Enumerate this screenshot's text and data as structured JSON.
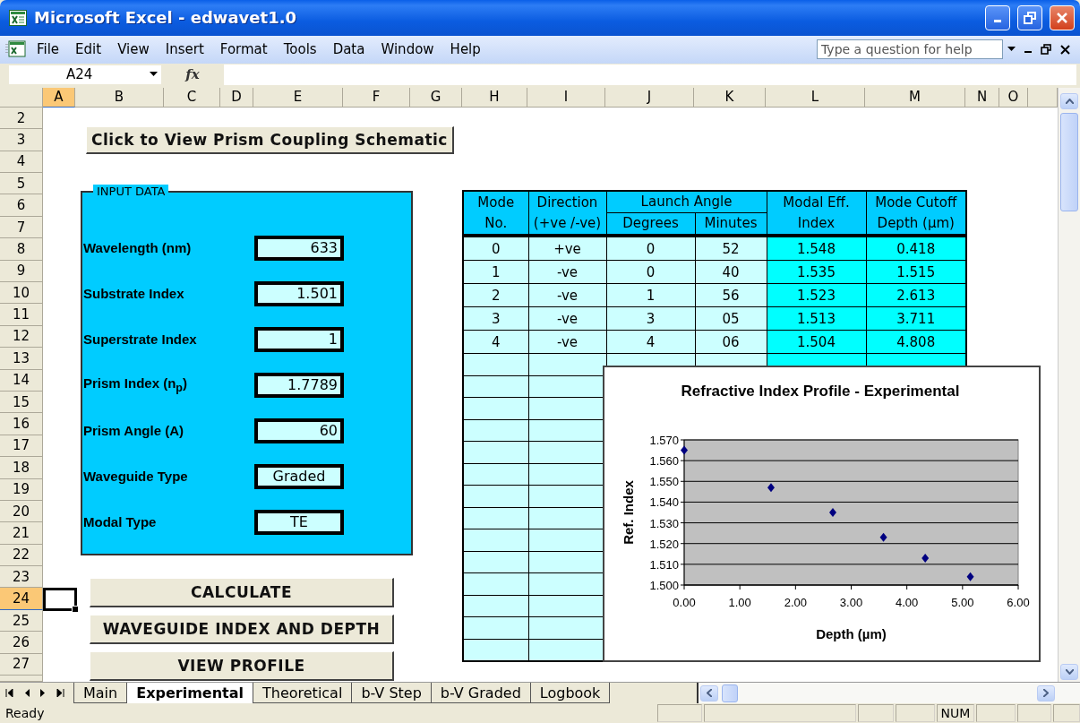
{
  "window": {
    "title": "Microsoft Excel - edwavet1.0"
  },
  "menu": [
    "File",
    "Edit",
    "View",
    "Insert",
    "Format",
    "Tools",
    "Data",
    "Window",
    "Help"
  ],
  "help_search": {
    "placeholder": "Type a question for help"
  },
  "formula_bar": {
    "name_box": "A24",
    "function_label": "fx"
  },
  "columns": [
    {
      "label": "A",
      "selected": true
    },
    {
      "label": "B",
      "selected": false
    },
    {
      "label": "C",
      "selected": false
    },
    {
      "label": "D",
      "selected": false
    },
    {
      "label": "E",
      "selected": false
    },
    {
      "label": "F",
      "selected": false
    },
    {
      "label": "G",
      "selected": false
    },
    {
      "label": "H",
      "selected": false
    },
    {
      "label": "I",
      "selected": false
    },
    {
      "label": "J",
      "selected": false
    },
    {
      "label": "K",
      "selected": false
    },
    {
      "label": "L",
      "selected": false
    },
    {
      "label": "M",
      "selected": false
    },
    {
      "label": "N",
      "selected": false
    },
    {
      "label": "O",
      "selected": false
    }
  ],
  "rows": [
    {
      "label": "2",
      "selected": false
    },
    {
      "label": "3",
      "selected": false
    },
    {
      "label": "4",
      "selected": false
    },
    {
      "label": "5",
      "selected": false
    },
    {
      "label": "6",
      "selected": false
    },
    {
      "label": "7",
      "selected": false
    },
    {
      "label": "8",
      "selected": false
    },
    {
      "label": "9",
      "selected": false
    },
    {
      "label": "10",
      "selected": false
    },
    {
      "label": "11",
      "selected": false
    },
    {
      "label": "12",
      "selected": false
    },
    {
      "label": "13",
      "selected": false
    },
    {
      "label": "14",
      "selected": false
    },
    {
      "label": "15",
      "selected": false
    },
    {
      "label": "16",
      "selected": false
    },
    {
      "label": "17",
      "selected": false
    },
    {
      "label": "18",
      "selected": false
    },
    {
      "label": "19",
      "selected": false
    },
    {
      "label": "20",
      "selected": false
    },
    {
      "label": "21",
      "selected": false
    },
    {
      "label": "22",
      "selected": false
    },
    {
      "label": "23",
      "selected": false
    },
    {
      "label": "24",
      "selected": true
    },
    {
      "label": "25",
      "selected": false
    },
    {
      "label": "26",
      "selected": false
    },
    {
      "label": "27",
      "selected": false
    }
  ],
  "schematic_button": "Click to View Prism Coupling Schematic",
  "input_panel": {
    "title": "INPUT DATA",
    "fields": [
      {
        "label": "Wavelength (nm)",
        "value": "633",
        "kind": "number"
      },
      {
        "label": "Substrate Index",
        "value": "1.501",
        "kind": "number"
      },
      {
        "label": "Superstrate Index",
        "value": "1",
        "kind": "number"
      },
      {
        "label": "Prism Index (n$_{p}$)",
        "value": "1.7789",
        "kind": "number"
      },
      {
        "label": "Prism Angle (A)",
        "value": "60",
        "kind": "number"
      },
      {
        "label": "Waveguide Type",
        "value": "Graded",
        "kind": "text"
      },
      {
        "label": "Modal Type",
        "value": "TE",
        "kind": "text"
      }
    ]
  },
  "actions": [
    "CALCULATE",
    "WAVEGUIDE INDEX AND DEPTH",
    "VIEW PROFILE"
  ],
  "mode_table": {
    "header": [
      {
        "kind": "single",
        "lines": [
          "Mode",
          "No."
        ],
        "result": false
      },
      {
        "kind": "single",
        "lines": [
          "Direction",
          "(+ve /-ve)"
        ],
        "result": false
      },
      {
        "kind": "group",
        "label": "Launch Angle",
        "sub": [
          "Degrees",
          "Minutes"
        ],
        "result": false
      },
      {
        "kind": "single",
        "lines": [
          "Modal Eff.",
          "Index"
        ],
        "result": true
      },
      {
        "kind": "single",
        "lines": [
          "Mode Cutoff",
          "Depth (µm)"
        ],
        "result": true
      }
    ],
    "rows": [
      [
        "0",
        "+ve",
        "0",
        "52",
        "1.548",
        "0.418"
      ],
      [
        "1",
        "-ve",
        "0",
        "40",
        "1.535",
        "1.515"
      ],
      [
        "2",
        "-ve",
        "1",
        "56",
        "1.523",
        "2.613"
      ],
      [
        "3",
        "-ve",
        "3",
        "05",
        "1.513",
        "3.711"
      ],
      [
        "4",
        "-ve",
        "4",
        "06",
        "1.504",
        "4.808"
      ]
    ]
  },
  "chart": {
    "chart_data": {
      "type": "scatter",
      "title": "Refractive Index Profile - Experimental",
      "xlabel": "Depth (µm)",
      "ylabel": "Ref. Index",
      "x": [
        0,
        1.56,
        2.67,
        3.58,
        4.33,
        5.14
      ],
      "series": [
        {
          "color": "#000080",
          "values": [
            1.565,
            1.547,
            1.535,
            1.523,
            1.513,
            1.504
          ]
        }
      ],
      "xlim": [
        0,
        6
      ],
      "ylim": [
        1.5,
        1.57
      ],
      "grid": true,
      "xticks": [
        {
          "value": 0,
          "label": "0.00"
        },
        {
          "value": 1,
          "label": "1.00"
        },
        {
          "value": 2,
          "label": "2.00"
        },
        {
          "value": 3,
          "label": "3.00"
        },
        {
          "value": 4,
          "label": "4.00"
        },
        {
          "value": 5,
          "label": "5.00"
        },
        {
          "value": 6,
          "label": "6.00"
        }
      ],
      "yticks": [
        {
          "value": 1.5,
          "label": "1.500"
        },
        {
          "value": 1.51,
          "label": "1.510"
        },
        {
          "value": 1.52,
          "label": "1.520"
        },
        {
          "value": 1.53,
          "label": "1.530"
        },
        {
          "value": 1.54,
          "label": "1.540"
        },
        {
          "value": 1.55,
          "label": "1.550"
        },
        {
          "value": 1.56,
          "label": "1.560"
        },
        {
          "value": 1.57,
          "label": "1.570"
        }
      ]
    }
  },
  "sheet_tabs": [
    {
      "label": "Main",
      "selected": false
    },
    {
      "label": "Experimental",
      "selected": true
    },
    {
      "label": "Theoretical",
      "selected": false
    },
    {
      "label": "b-V Step",
      "selected": false
    },
    {
      "label": "b-V  Graded",
      "selected": false
    },
    {
      "label": "Logbook",
      "selected": false
    }
  ],
  "status_bar": {
    "text": "Ready",
    "indicators": [
      "NUM"
    ]
  }
}
